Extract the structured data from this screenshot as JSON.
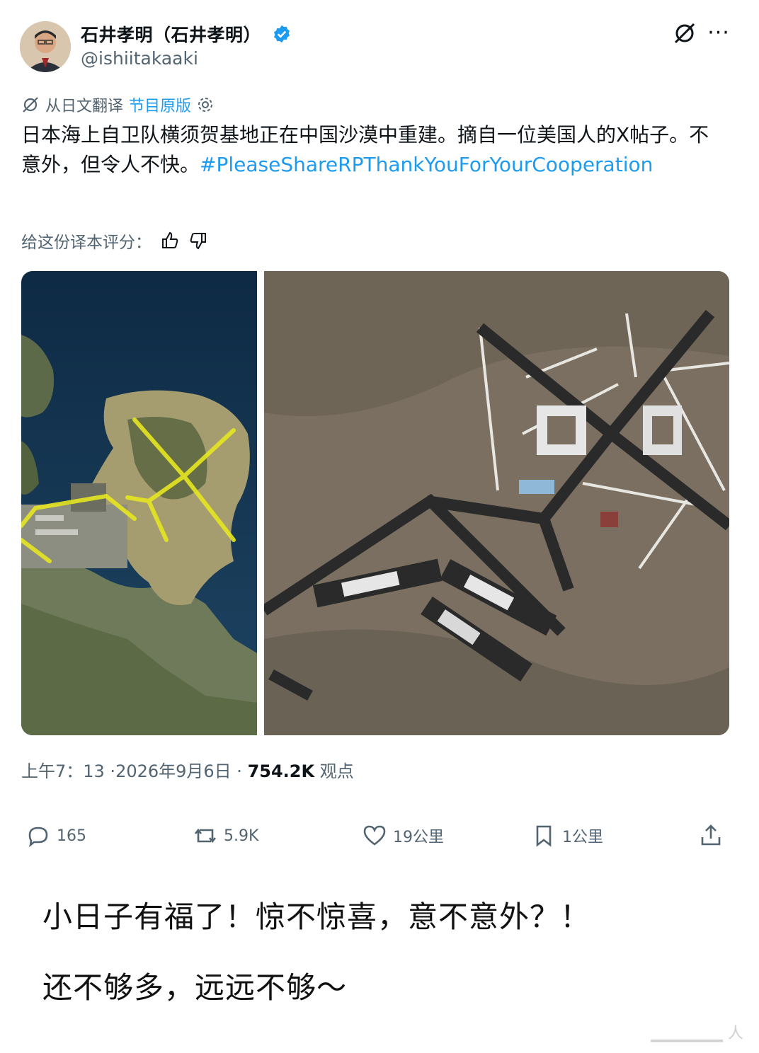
{
  "header": {
    "display_name": "石井孝明（石井孝明）",
    "handle": "@ishiitakaaki",
    "verified_color": "#1d9bf0",
    "grok_icon": "grok-icon",
    "more_icon": "more-icon"
  },
  "translation": {
    "label": "从日文翻译",
    "original_link": "节目原版",
    "settings_icon": "gear-icon"
  },
  "post": {
    "text_main": "日本海上自卫队横须贺基地正在中国沙漠中重建。摘自一位美国人的X帖子。不意外，但令人不快。",
    "hashtag": "#PleaseShareRPThankYouForYourCooperation"
  },
  "rate": {
    "label": "给这份译本评分：",
    "thumbs_up_icon": "thumbs-up-icon",
    "thumbs_down_icon": "thumbs-down-icon"
  },
  "meta": {
    "time": "上午7：13 ·2026年9月6日 · ",
    "views": "754.2K",
    "views_label": " 观点"
  },
  "actions": {
    "replies": "165",
    "reposts": "5.9K",
    "likes": "19公里",
    "bookmarks": "1公里"
  },
  "comment": {
    "line1": "小日子有福了！惊不惊喜，意不意外？！",
    "line2": "还不够多，远远不够～"
  },
  "colors": {
    "link": "#1d9bf0",
    "secondary_text": "#536471",
    "highlight_roads": "#e6e621"
  }
}
